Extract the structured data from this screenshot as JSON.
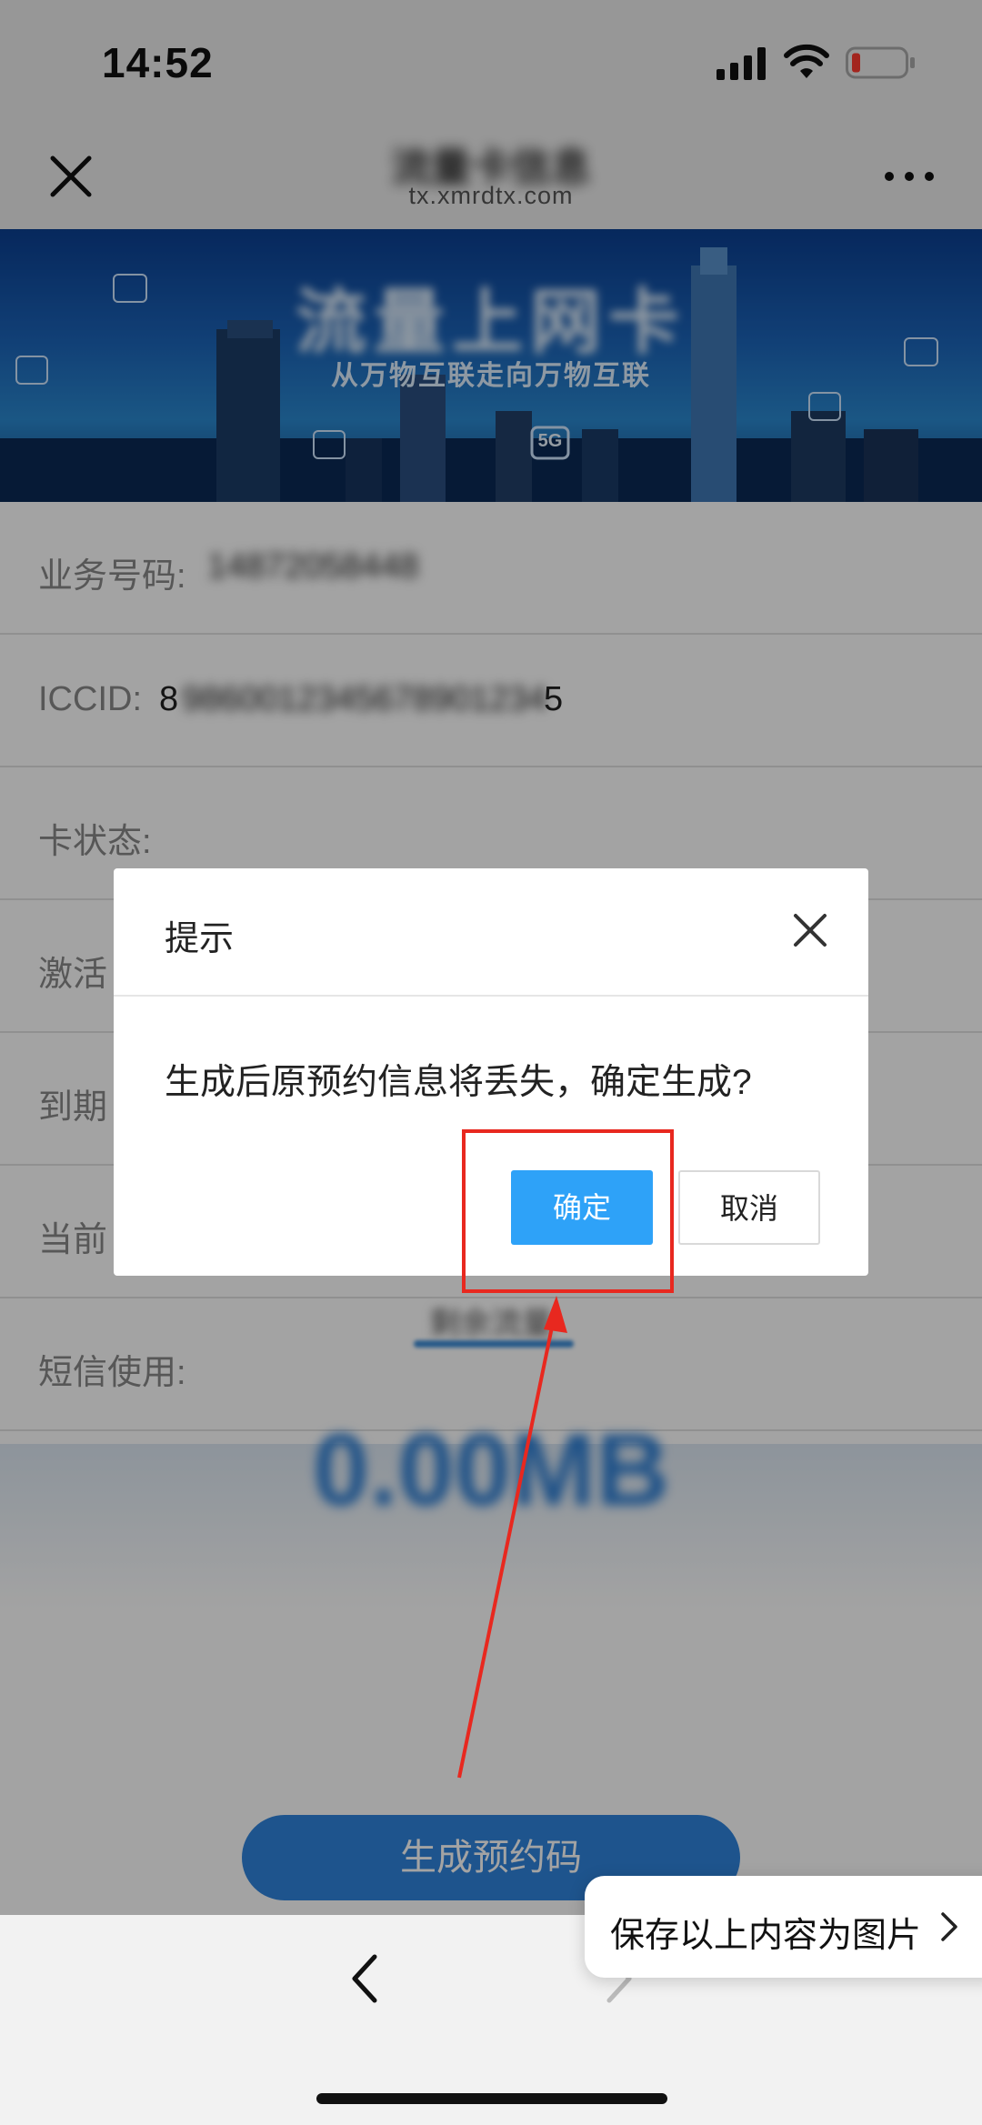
{
  "status_bar": {
    "time": "14:52"
  },
  "nav": {
    "title": "流量卡信息",
    "url": "tx.xmrdtx.com"
  },
  "banner": {
    "title": "流量上网卡",
    "subtitle": "从万物互联走向万物互联",
    "badge": "5G"
  },
  "info_rows": [
    {
      "label": "业务号码:",
      "value": "14872058448"
    },
    {
      "label": "ICCID:",
      "value_visible": "8",
      "value_masked": "9860012345678901234",
      "value_tail": "5"
    },
    {
      "label": "卡状态:"
    },
    {
      "label": "激活"
    },
    {
      "label": "到期"
    },
    {
      "label": "当前"
    },
    {
      "label": "短信使用:"
    }
  ],
  "usage": {
    "label": "剩余流量",
    "value": "0.00MB"
  },
  "generate_button": "生成预约码",
  "dialog": {
    "title": "提示",
    "message": "生成后原预约信息将丢失，确定生成?",
    "confirm": "确定",
    "cancel": "取消"
  },
  "save_prompt": {
    "text": "保存以上内容为图片"
  },
  "colors": {
    "primary": "#2ea2f8",
    "annotation": "#e8281f",
    "button": "#2f84dd"
  }
}
